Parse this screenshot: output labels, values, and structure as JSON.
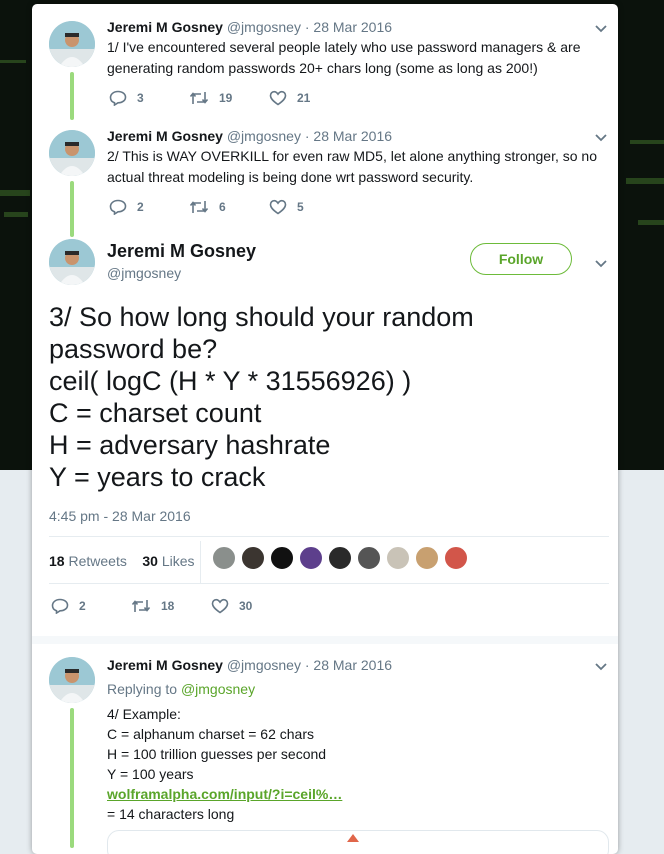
{
  "tweets": [
    {
      "name": "Jeremi M Gosney",
      "handle": "@jmgosney",
      "date": "· 28 Mar 2016",
      "lines": [
        "1/ I've encountered several people lately who use password managers & are",
        "generating random passwords 20+ chars long (some as long as 200!)"
      ],
      "replies": "3",
      "retweets": "19",
      "likes": "21"
    },
    {
      "name": "Jeremi M Gosney",
      "handle": "@jmgosney",
      "date": "· 28 Mar 2016",
      "lines": [
        "2/ This is WAY OVERKILL for even raw MD5, let alone anything stronger, so no",
        "actual threat modeling is being done wrt password security."
      ],
      "replies": "2",
      "retweets": "6",
      "likes": "5"
    }
  ],
  "main": {
    "name": "Jeremi M Gosney",
    "handle": "@jmgosney",
    "follow_label": "Follow",
    "lines": [
      "3/ So how long should your random",
      "password be?",
      "ceil( logC (H * Y * 31556926) )",
      "C = charset count",
      "H = adversary hashrate",
      "Y = years to crack"
    ],
    "timestamp": "4:45 pm - 28 Mar 2016",
    "retweet_count": "18",
    "retweet_label": "Retweets",
    "like_count": "30",
    "like_label": "Likes",
    "replies": "2",
    "retweets": "18",
    "likes": "30"
  },
  "reply": {
    "name": "Jeremi M Gosney",
    "handle": "@jmgosney",
    "date": "· 28 Mar 2016",
    "replying_prefix": "Replying to",
    "replying_handle": "@jmgosney",
    "lines": [
      "4/ Example:",
      "C = alphanum charset = 62 chars",
      "H = 100 trillion guesses per second",
      "Y = 100 years"
    ],
    "link": "wolframalpha.com/input/?i=ceil%…",
    "result": "= 14 characters long"
  },
  "colors": {
    "accent": "#5aa52a",
    "thread_line": "#9bda7d",
    "muted": "#657786",
    "text": "#14171a"
  },
  "icons": [
    "reply-icon",
    "retweet-icon",
    "like-icon",
    "caret-down-icon"
  ]
}
